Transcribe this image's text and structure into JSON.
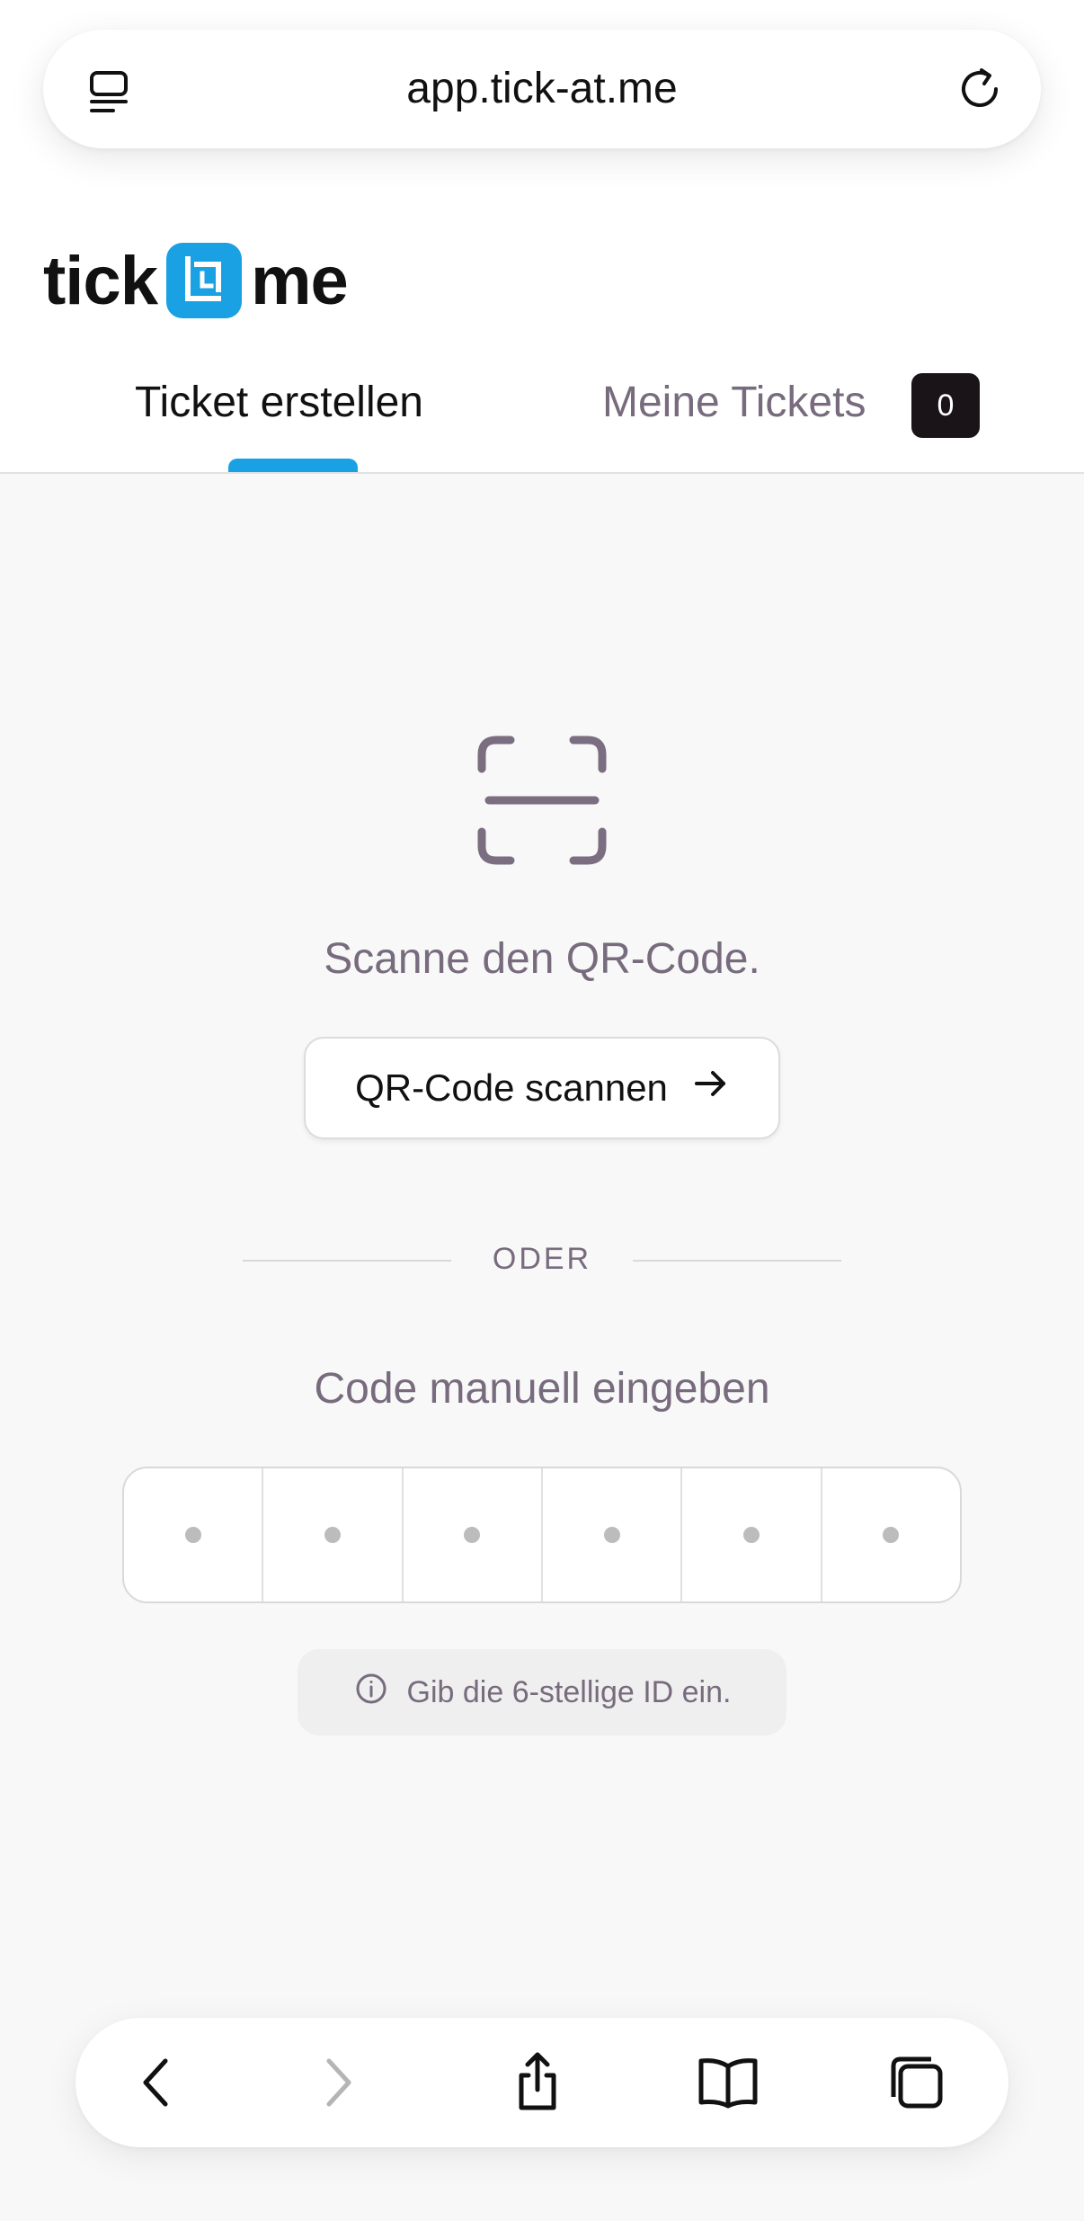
{
  "browser": {
    "url": "app.tick-at.me",
    "icons": [
      "menu-icon",
      "reload-icon"
    ]
  },
  "logo": {
    "word_left": "tick",
    "word_right": "me",
    "brand_color": "#1aa1e3"
  },
  "tabs": {
    "create_label": "Ticket erstellen",
    "mine_label": "Meine Tickets",
    "mine_count": "0",
    "active": "create"
  },
  "main": {
    "scan_text": "Scanne den QR-Code.",
    "scan_button_label": "QR-Code scannen",
    "divider_label": "ODER",
    "manual_label": "Code manuell eingeben",
    "code_slots": [
      "",
      "",
      "",
      "",
      "",
      ""
    ],
    "hint_text": "Gib die 6-stellige ID ein."
  },
  "toolbar": {
    "items": [
      "back-icon",
      "forward-icon",
      "share-icon",
      "bookmarks-icon",
      "tabs-icon"
    ]
  },
  "colors": {
    "accent": "#1aa1e3",
    "muted_text": "#776b7d",
    "badge_bg": "#1a1418"
  }
}
